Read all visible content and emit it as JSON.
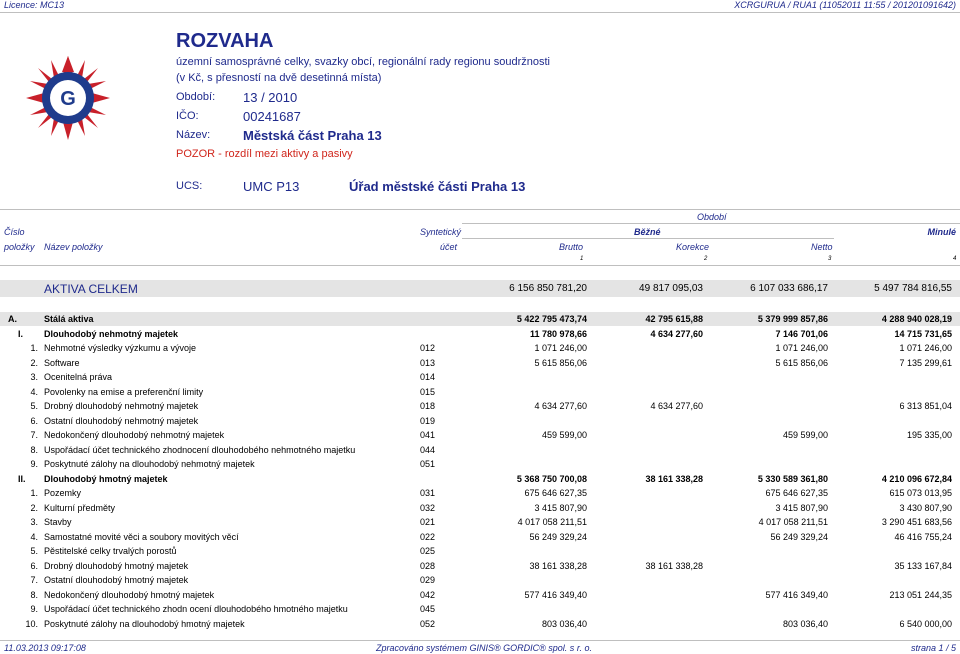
{
  "top": {
    "license": "Licence: MC13",
    "info": "XCRGURUA / RUA1  (11052011 11:55 / 201201091642)"
  },
  "header": {
    "title": "ROZVAHA",
    "subtitle1": "územní samosprávné celky, svazky obcí, regionální rady regionu soudržnosti",
    "subtitle2": "(v Kč, s přesností na dvě desetinná místa)",
    "obdobi_label": "Období:",
    "obdobi_value": "13 / 2010",
    "ico_label": "IČO:",
    "ico_value": "00241687",
    "nazev_label": "Název:",
    "nazev_value": "Městská část Praha 13",
    "warning": "POZOR - rozdíl mezi aktivy a pasivy",
    "ucs_label": "UCS:",
    "ucs_value": "UMC P13",
    "ucs_name": "Úřad městské části Praha 13"
  },
  "columns": {
    "obdobi": "Období",
    "cislo": "Číslo",
    "polozky": "položky",
    "nazev": "Název položky",
    "synteticky": "Syntetický",
    "ucet": "účet",
    "bezne": "Běžné",
    "minule": "Minulé",
    "brutto": "Brutto",
    "korekce": "Korekce",
    "netto": "Netto",
    "n1": "1",
    "n2": "2",
    "n3": "3",
    "n4": "4"
  },
  "aktiva": {
    "label": "AKTIVA CELKEM",
    "brutto": "6 156 850 781,20",
    "korekce": "49 817 095,03",
    "netto": "6 107 033 686,17",
    "minule": "5 497 784 816,55"
  },
  "rows": [
    {
      "num": "A.",
      "name": "Stálá aktiva",
      "acct": "",
      "brutto": "5 422 795 473,74",
      "korekce": "42 795 615,88",
      "netto": "5 379 999 857,86",
      "minule": "4 288 940 028,19",
      "level": "A"
    },
    {
      "num": "I.",
      "name": "Dlouhodobý nehmotný majetek",
      "acct": "",
      "brutto": "11 780 978,66",
      "korekce": "4 634 277,60",
      "netto": "7 146 701,06",
      "minule": "14 715 731,65",
      "level": "I"
    },
    {
      "num": "1.",
      "name": "Nehmotné výsledky výzkumu a vývoje",
      "acct": "012",
      "brutto": "1 071 246,00",
      "korekce": "",
      "netto": "1 071 246,00",
      "minule": "1 071 246,00",
      "level": "n"
    },
    {
      "num": "2.",
      "name": "Software",
      "acct": "013",
      "brutto": "5 615 856,06",
      "korekce": "",
      "netto": "5 615 856,06",
      "minule": "7 135 299,61",
      "level": "n"
    },
    {
      "num": "3.",
      "name": "Ocenitelná práva",
      "acct": "014",
      "brutto": "",
      "korekce": "",
      "netto": "",
      "minule": "",
      "level": "n"
    },
    {
      "num": "4.",
      "name": "Povolenky na emise a preferenční limity",
      "acct": "015",
      "brutto": "",
      "korekce": "",
      "netto": "",
      "minule": "",
      "level": "n"
    },
    {
      "num": "5.",
      "name": "Drobný dlouhodobý nehmotný majetek",
      "acct": "018",
      "brutto": "4 634 277,60",
      "korekce": "4 634 277,60",
      "netto": "",
      "minule": "6 313 851,04",
      "level": "n"
    },
    {
      "num": "6.",
      "name": "Ostatní dlouhodobý nehmotný majetek",
      "acct": "019",
      "brutto": "",
      "korekce": "",
      "netto": "",
      "minule": "",
      "level": "n"
    },
    {
      "num": "7.",
      "name": "Nedokončený dlouhodobý nehmotný majetek",
      "acct": "041",
      "brutto": "459 599,00",
      "korekce": "",
      "netto": "459 599,00",
      "minule": "195 335,00",
      "level": "n"
    },
    {
      "num": "8.",
      "name": "Uspořádací účet technického zhodnocení dlouhodobého nehmotného majetku",
      "acct": "044",
      "brutto": "",
      "korekce": "",
      "netto": "",
      "minule": "",
      "level": "n"
    },
    {
      "num": "9.",
      "name": "Poskytnuté zálohy na dlouhodobý nehmotný majetek",
      "acct": "051",
      "brutto": "",
      "korekce": "",
      "netto": "",
      "minule": "",
      "level": "n"
    },
    {
      "num": "II.",
      "name": "Dlouhodobý hmotný majetek",
      "acct": "",
      "brutto": "5 368 750 700,08",
      "korekce": "38 161 338,28",
      "netto": "5 330 589 361,80",
      "minule": "4 210 096 672,84",
      "level": "I"
    },
    {
      "num": "1.",
      "name": "Pozemky",
      "acct": "031",
      "brutto": "675 646 627,35",
      "korekce": "",
      "netto": "675 646 627,35",
      "minule": "615 073 013,95",
      "level": "n"
    },
    {
      "num": "2.",
      "name": "Kulturní předměty",
      "acct": "032",
      "brutto": "3 415 807,90",
      "korekce": "",
      "netto": "3 415 807,90",
      "minule": "3 430 807,90",
      "level": "n"
    },
    {
      "num": "3.",
      "name": "Stavby",
      "acct": "021",
      "brutto": "4 017 058 211,51",
      "korekce": "",
      "netto": "4 017 058 211,51",
      "minule": "3 290 451 683,56",
      "level": "n"
    },
    {
      "num": "4.",
      "name": "Samostatné movité věci a soubory movitých věcí",
      "acct": "022",
      "brutto": "56 249 329,24",
      "korekce": "",
      "netto": "56 249 329,24",
      "minule": "46 416 755,24",
      "level": "n"
    },
    {
      "num": "5.",
      "name": "Pěstitelské celky trvalých porostů",
      "acct": "025",
      "brutto": "",
      "korekce": "",
      "netto": "",
      "minule": "",
      "level": "n"
    },
    {
      "num": "6.",
      "name": "Drobný dlouhodobý hmotný majetek",
      "acct": "028",
      "brutto": "38 161 338,28",
      "korekce": "38 161 338,28",
      "netto": "",
      "minule": "35 133 167,84",
      "level": "n"
    },
    {
      "num": "7.",
      "name": "Ostatní dlouhodobý hmotný majetek",
      "acct": "029",
      "brutto": "",
      "korekce": "",
      "netto": "",
      "minule": "",
      "level": "n"
    },
    {
      "num": "8.",
      "name": "Nedokončený dlouhodobý hmotný majetek",
      "acct": "042",
      "brutto": "577 416 349,40",
      "korekce": "",
      "netto": "577 416 349,40",
      "minule": "213 051 244,35",
      "level": "n"
    },
    {
      "num": "9.",
      "name": "Uspořádací účet technického zhodn ocení dlouhodobého hmotného majetku",
      "acct": "045",
      "brutto": "",
      "korekce": "",
      "netto": "",
      "minule": "",
      "level": "n"
    },
    {
      "num": "10.",
      "name": "Poskytnuté zálohy na dlouhodobý hmotný majetek",
      "acct": "052",
      "brutto": "803 036,40",
      "korekce": "",
      "netto": "803 036,40",
      "minule": "6 540 000,00",
      "level": "n"
    }
  ],
  "footer": {
    "date": "11.03.2013 09:17:08",
    "system": "Zpracováno systémem  GINIS® GORDIC® spol. s  r. o.",
    "page": "strana 1 / 5"
  },
  "colors": {
    "text_blue": "#1f2a8c",
    "warning_red": "#d0261c",
    "logo_red": "#c8202a",
    "logo_blue": "#1f3c8c"
  }
}
